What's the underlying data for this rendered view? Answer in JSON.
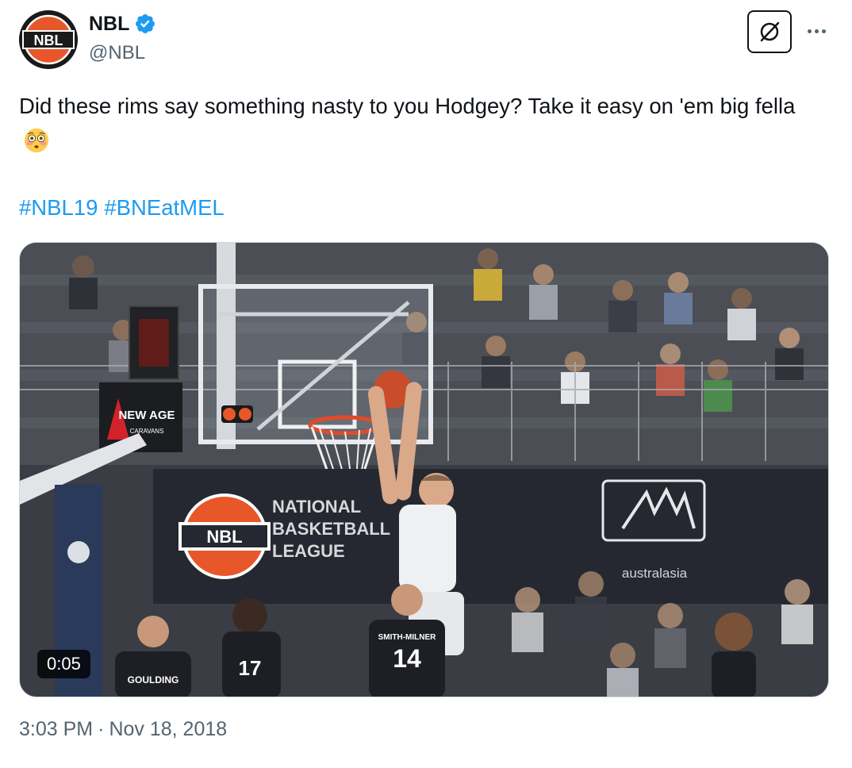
{
  "author": {
    "display_name": "NBL",
    "handle": "@NBL",
    "avatar_text": "NBL",
    "verified": true
  },
  "tweet": {
    "text": "Did these rims say something nasty to you Hodgey? Take it easy on 'em big fella",
    "emoji": "flushed-face",
    "hashtags": [
      "#NBL19",
      "#BNEatMEL"
    ]
  },
  "media": {
    "type": "video",
    "duration": "0:05",
    "scene_text": {
      "sponsor_name": "NEW AGE",
      "sponsor_sub": "CARAVANS",
      "league_logo": "NBL",
      "league_name_1": "NATIONAL",
      "league_name_2": "BASKETBALL",
      "league_name_3": "LEAGUE",
      "sponsor2": "australasia",
      "jersey1_name": "SMITH-MILNER",
      "jersey1_number": "14",
      "jersey2_number": "17",
      "jersey3_name": "GOULDING"
    }
  },
  "meta": {
    "time": "3:03 PM",
    "separator": "·",
    "date": "Nov 18, 2018"
  },
  "colors": {
    "link": "#1d9bf0",
    "secondary_text": "#536471",
    "verified": "#1d9bf0",
    "nbl_orange": "#e8572a"
  }
}
